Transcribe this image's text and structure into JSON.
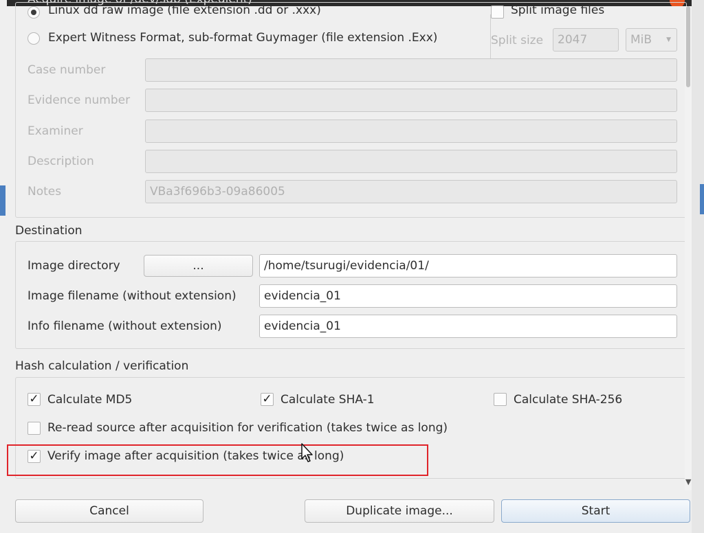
{
  "window": {
    "title": "Acquire image of /dev/sdb (Expedient)"
  },
  "format": {
    "options": [
      {
        "label": "Linux dd raw image (file extension .dd or .xxx)",
        "checked": true
      },
      {
        "label": "Expert Witness Format, sub-format Guymager (file extension .Exx)",
        "checked": false
      }
    ],
    "split_label": "Split image files",
    "split_size_label": "Split size",
    "split_size_value": "2047",
    "split_unit": "MiB"
  },
  "case_info": {
    "fields": [
      {
        "label": "Case number",
        "value": ""
      },
      {
        "label": "Evidence number",
        "value": ""
      },
      {
        "label": "Examiner",
        "value": ""
      },
      {
        "label": "Description",
        "value": ""
      },
      {
        "label": "Notes",
        "value": "VBa3f696b3-09a86005"
      }
    ]
  },
  "destination": {
    "title": "Destination",
    "image_directory_label": "Image directory",
    "browse_label": "...",
    "image_directory_value": "/home/tsurugi/evidencia/01/",
    "image_filename_label": "Image filename (without extension)",
    "image_filename_value": "evidencia_01",
    "info_filename_label": "Info filename (without extension)",
    "info_filename_value": "evidencia_01"
  },
  "hash": {
    "title": "Hash calculation / verification",
    "md5": {
      "label": "Calculate MD5",
      "checked": true
    },
    "sha1": {
      "label": "Calculate SHA-1",
      "checked": true
    },
    "sha256": {
      "label": "Calculate SHA-256",
      "checked": false
    },
    "reread": {
      "label": "Re-read source after acquisition for verification (takes twice as long)",
      "checked": false
    },
    "verify": {
      "label": "Verify image after acquisition (takes twice as long)",
      "checked": true
    }
  },
  "buttons": {
    "cancel": "Cancel",
    "duplicate": "Duplicate image...",
    "start": "Start"
  },
  "colors": {
    "highlight": "#e0242a",
    "close": "#e95420"
  }
}
